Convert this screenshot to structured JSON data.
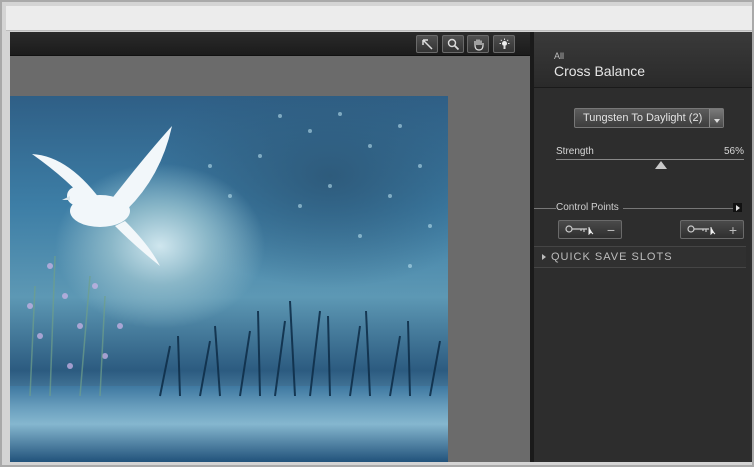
{
  "toolbar": {
    "tools": [
      {
        "name": "arrow-select-tool",
        "icon": "arrow-icon"
      },
      {
        "name": "zoom-tool",
        "icon": "magnifier-icon"
      },
      {
        "name": "hand-tool",
        "icon": "hand-icon"
      },
      {
        "name": "light-tool",
        "icon": "lightbulb-icon"
      }
    ]
  },
  "panel": {
    "category": "All",
    "title": "Cross Balance",
    "preset": {
      "value": "Tungsten To Daylight (2)"
    },
    "strength": {
      "label": "Strength",
      "value": "56%",
      "fraction": 0.56
    },
    "control_points": {
      "label": "Control Points"
    },
    "quick_save": {
      "label": "QUICK SAVE SLOTS"
    }
  },
  "colors": {
    "panel_bg": "#2d2d2d",
    "toolbar_bg": "#1b1b1b",
    "canvas_bg": "#6b6b6b"
  }
}
